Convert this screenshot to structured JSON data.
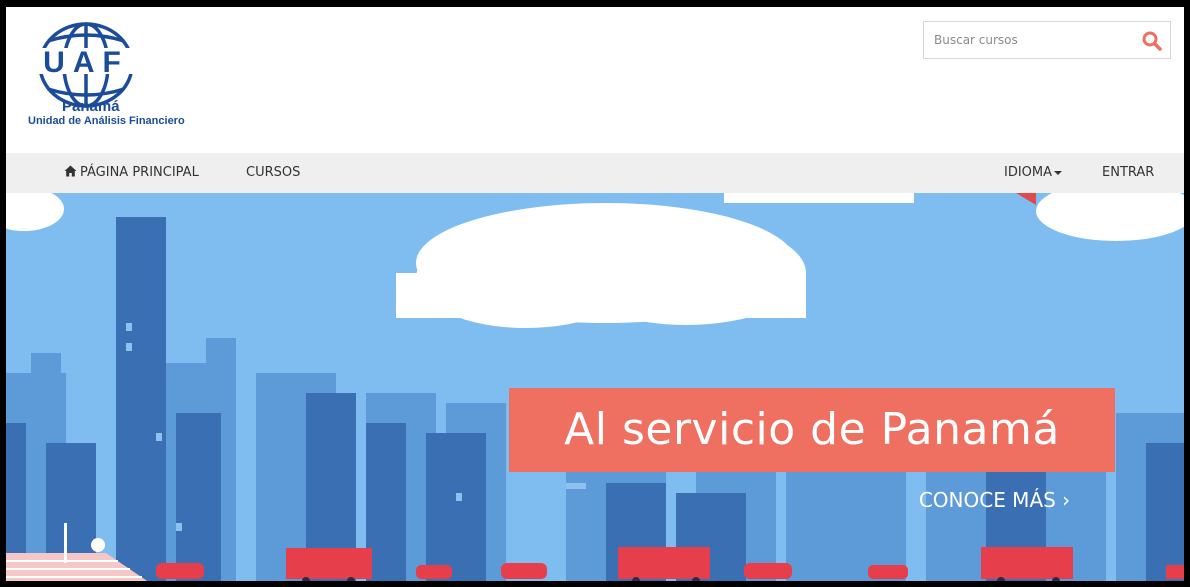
{
  "brand": {
    "logo_letters": "UAF",
    "country": "Panamá",
    "org_name": "Unidad de Análisis Financiero"
  },
  "search": {
    "placeholder": "Buscar cursos",
    "icon": "search-icon",
    "icon_color": "#ef6f60"
  },
  "nav": {
    "home_icon": "home-icon",
    "home_label": "PÁGINA PRINCIPAL",
    "courses_label": "CURSOS",
    "language_label": "IDIOMA",
    "login_label": "ENTRAR"
  },
  "hero": {
    "title": "Al servicio de Panamá",
    "cta": "CONOCE MÁS ›"
  },
  "colors": {
    "brand_blue": "#1b4c9a",
    "accent": "#ef6f60",
    "sky": "#7fbdf0",
    "nav_bg": "#efefef"
  }
}
